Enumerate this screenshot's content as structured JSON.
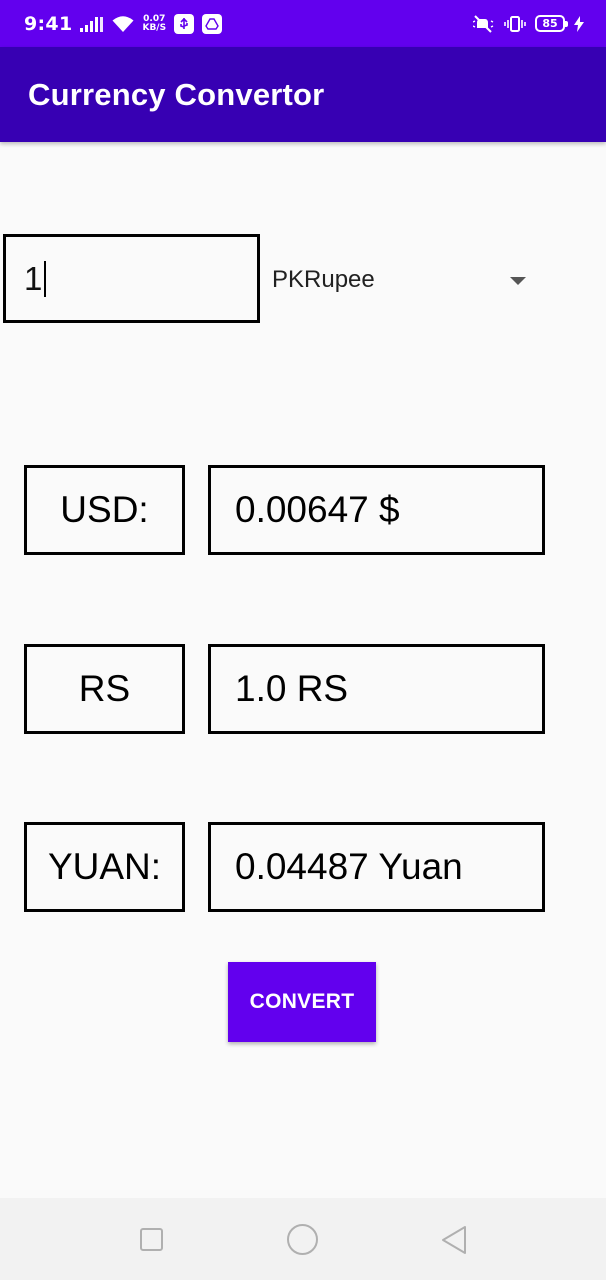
{
  "status_bar": {
    "time": "9:41",
    "speed_value": "0.07",
    "speed_unit": "KB/S",
    "battery": "85"
  },
  "app_bar": {
    "title": "Currency Convertor"
  },
  "converter": {
    "amount_value": "1",
    "selected_currency": "PKRupee"
  },
  "results": {
    "usd_label": "USD:",
    "usd_value": "0.00647 $",
    "rs_label": "RS",
    "rs_value": "1.0 RS",
    "yuan_label": "YUAN:",
    "yuan_value": "0.04487 Yuan"
  },
  "actions": {
    "convert_label": "CONVERT"
  },
  "colors": {
    "status_bar": "#6200ee",
    "app_bar": "#3700b3",
    "button": "#6200ee",
    "background": "#fafafa"
  },
  "icons": {
    "status": [
      "signal-icon",
      "wifi-icon",
      "usb-icon",
      "drive-icon",
      "mute-icon",
      "vibrate-icon",
      "battery-icon",
      "charging-icon"
    ],
    "nav": [
      "recent-apps-icon",
      "home-icon",
      "back-icon"
    ]
  }
}
